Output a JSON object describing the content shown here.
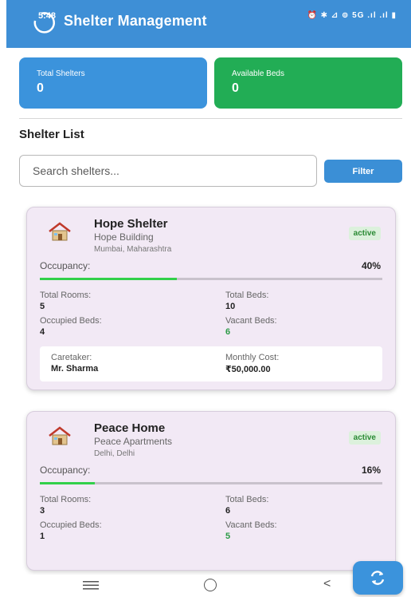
{
  "status_bar": {
    "time": "5:48",
    "icons_text": "⏰ ✱ ⊿ ⊚ 5G .ıl .ıl ▮"
  },
  "header": {
    "title": "Shelter Management"
  },
  "stats": {
    "total_shelters": {
      "label": "Total Shelters",
      "value": "0",
      "color": "#3b93dc"
    },
    "available_beds": {
      "label": "Available Beds",
      "value": "0",
      "color": "#22ad55"
    }
  },
  "shelter_list": {
    "title": "Shelter List",
    "search_placeholder": "Search shelters...",
    "filter_label": "Filter"
  },
  "shelters": [
    {
      "name": "Hope Shelter",
      "building": "Hope Building",
      "location": "Mumbai, Maharashtra",
      "status": "active",
      "occupancy_label": "Occupancy:",
      "occupancy_pct": "40%",
      "occupancy_fraction": 0.4,
      "total_rooms_label": "Total Rooms:",
      "total_rooms": "5",
      "total_beds_label": "Total Beds:",
      "total_beds": "10",
      "occupied_beds_label": "Occupied Beds:",
      "occupied_beds": "4",
      "vacant_beds_label": "Vacant Beds:",
      "vacant_beds": "6",
      "caretaker_label": "Caretaker:",
      "caretaker": "Mr. Sharma",
      "monthly_cost_label": "Monthly Cost:",
      "monthly_cost": "₹50,000.00"
    },
    {
      "name": "Peace Home",
      "building": "Peace Apartments",
      "location": "Delhi, Delhi",
      "status": "active",
      "occupancy_label": "Occupancy:",
      "occupancy_pct": "16%",
      "occupancy_fraction": 0.16,
      "total_rooms_label": "Total Rooms:",
      "total_rooms": "3",
      "total_beds_label": "Total Beds:",
      "total_beds": "6",
      "occupied_beds_label": "Occupied Beds:",
      "occupied_beds": "1",
      "vacant_beds_label": "Vacant Beds:",
      "vacant_beds": "5"
    }
  ],
  "colors": {
    "header_bg": "#3e8fd6",
    "accent_blue": "#3b93dc",
    "accent_green": "#22ad55",
    "progress_fill": "#32d04a",
    "card_bg": "#f2e9f5",
    "vacant_text": "#2b9a46"
  },
  "icons": {
    "house": "house-icon",
    "refresh": "refresh-icon",
    "nav_menu": "menu-icon",
    "nav_home": "home-circle-icon",
    "nav_back": "back-icon"
  }
}
